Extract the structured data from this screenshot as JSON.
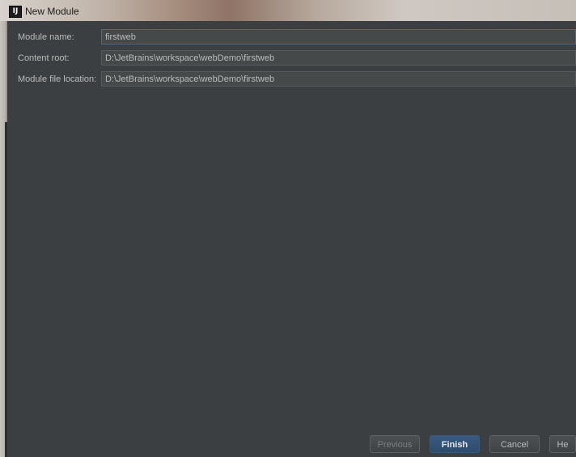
{
  "window": {
    "title": "New Module",
    "app_icon": "IJ"
  },
  "form": {
    "module_name": {
      "label": "Module name:",
      "value": "firstweb"
    },
    "content_root": {
      "label": "Content root:",
      "value": "D:\\JetBrains\\workspace\\webDemo\\firstweb"
    },
    "module_file_location": {
      "label": "Module file location:",
      "value": "D:\\JetBrains\\workspace\\webDemo\\firstweb"
    }
  },
  "buttons": {
    "previous": "Previous",
    "finish": "Finish",
    "cancel": "Cancel",
    "help": "He"
  },
  "colors": {
    "background": "#3c3f41",
    "field_background": "#45494a",
    "primary_button": "#385a82",
    "text": "#bbbbbb"
  }
}
